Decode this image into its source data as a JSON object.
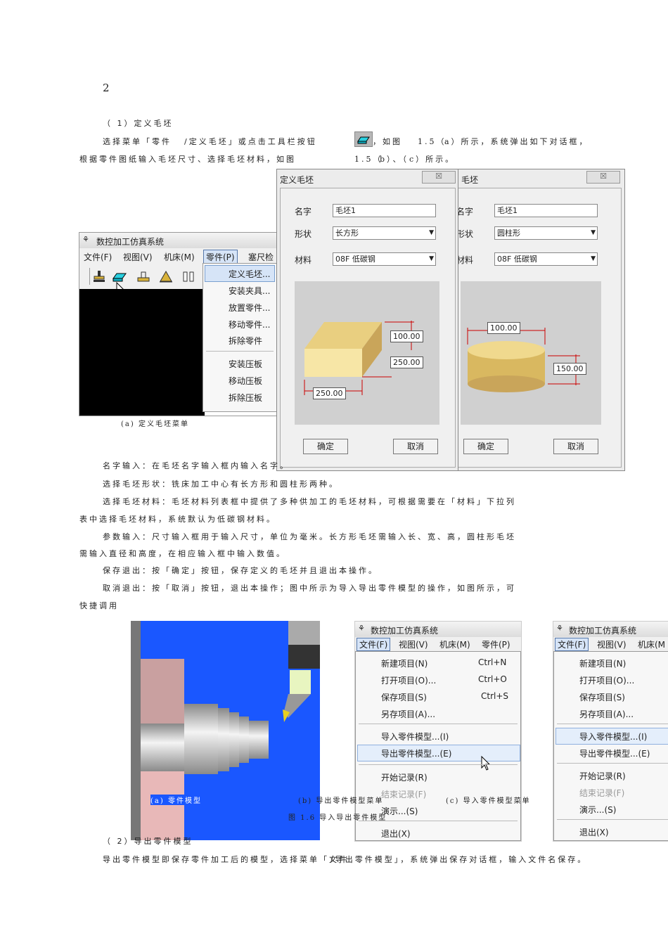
{
  "page_number": "2",
  "paragraphs": {
    "heading1": "（ 1）定义毛坯",
    "l1a": "选择菜单「零件",
    "l1b": "/定义毛坯」或点击工具栏按钮",
    "l1c": "，如图",
    "l1d": "1.5（",
    "l1e": "a）所示，系统弹出如下对话框，",
    "l2a": "根据零件图纸输入毛坯尺寸、选择毛坯材料，如图",
    "l2b": "1.5（",
    "l2c": "b）、（",
    "l2d": "c）所示。",
    "p1": "名字输入：在毛坯名字输入框内输入名字。",
    "p2": "选择毛坯形状：铣床加工中心有长方形和圆柱形两种。",
    "p3a": "选择毛坯材料：毛坯材料列表框中提供了多种供加工的毛坯材料，可根据需要在「材料」下拉列",
    "p3b": "表中选择毛坯材料，系统默认为低碳钢材料。",
    "p4a": "参数输入：尺寸输入框用于输入尺寸，单位为毫米。长方形毛坯需输入长、宽、高，圆柱形毛坯",
    "p4b": "需输入直径和高度，在相应输入框中输入数值。",
    "p5": "保存退出：按「确定」按钮，保存定义的毛坯并且退出本操作。",
    "p6a": "取消退出：按「取消」按钮，退出本操作；图中所示为导入导出零件模型的操作，如图所示，可",
    "p6b": "快捷调用",
    "heading2": "（ 2）导出零件模型",
    "last_a": "导出零件模型即保存零件加工后的模型，选择菜单「文件",
    "last_b": "/导出零件模型」，系统弹出保存对话框，输入文件名保存。"
  },
  "fig15": {
    "app_title": "数控加工仿真系统",
    "menubar": [
      "文件(F)",
      "视图(V)",
      "机床(M)",
      "零件(P)",
      "塞尺检"
    ],
    "part_menu": [
      "定义毛坯...",
      "安装夹具...",
      "放置零件...",
      "移动零件...",
      "拆除零件",
      "安装压板",
      "移动压板",
      "拆除压板"
    ],
    "caption_a": "(a) 定义毛坯菜单",
    "dialog_b": {
      "title": "定义毛坯",
      "name_label": "名字",
      "name_value": "毛坯1",
      "shape_label": "形状",
      "shape_value": "长方形",
      "material_label": "材料",
      "material_value": "08F 低碳钢",
      "dim1": "100.00",
      "dim2": "250.00",
      "dim3": "250.00",
      "ok": "确定",
      "cancel": "取消"
    },
    "dialog_c": {
      "title": "毛坯",
      "name_label": "名字",
      "name_value": "毛坯1",
      "shape_label": "形状",
      "shape_value": "圆柱形",
      "material_label": "材料",
      "material_value": "08F 低碳钢",
      "dim1": "100.00",
      "dim2": "150.00",
      "ok": "确定",
      "cancel": "取消"
    }
  },
  "fig16": {
    "file_menubar": [
      "文件(F)",
      "视图(V)",
      "机床(M)",
      "零件(P)"
    ],
    "file_menu": [
      {
        "label": "新建项目(N)",
        "shortcut": "Ctrl+N"
      },
      {
        "label": "打开项目(O)...",
        "shortcut": "Ctrl+O"
      },
      {
        "label": "保存项目(S)",
        "shortcut": "Ctrl+S"
      },
      {
        "label": "另存项目(A)...",
        "shortcut": ""
      },
      {
        "label": "导入零件模型...(I)",
        "shortcut": ""
      },
      {
        "label": "导出零件模型...(E)",
        "shortcut": ""
      },
      {
        "label": "开始记录(R)",
        "shortcut": ""
      },
      {
        "label": "结束记录(F)",
        "shortcut": ""
      },
      {
        "label": "演示...(S)",
        "shortcut": ""
      },
      {
        "label": "退出(X)",
        "shortcut": ""
      }
    ],
    "menubar_c": [
      "文件(F)",
      "视图(V)",
      "机床(M"
    ],
    "caption_a": "(a) 零件模型",
    "caption_b": "(b) 导出零件模型菜单",
    "caption_c": "(c) 导入零件模型菜单",
    "caption_main": "图 1.6 导入导出零件模型"
  },
  "colors": {
    "blue_bg": "#1a57ff",
    "block_top": "#e9cf80",
    "block_front": "#f7e6a6",
    "block_side": "#c9a55a"
  }
}
